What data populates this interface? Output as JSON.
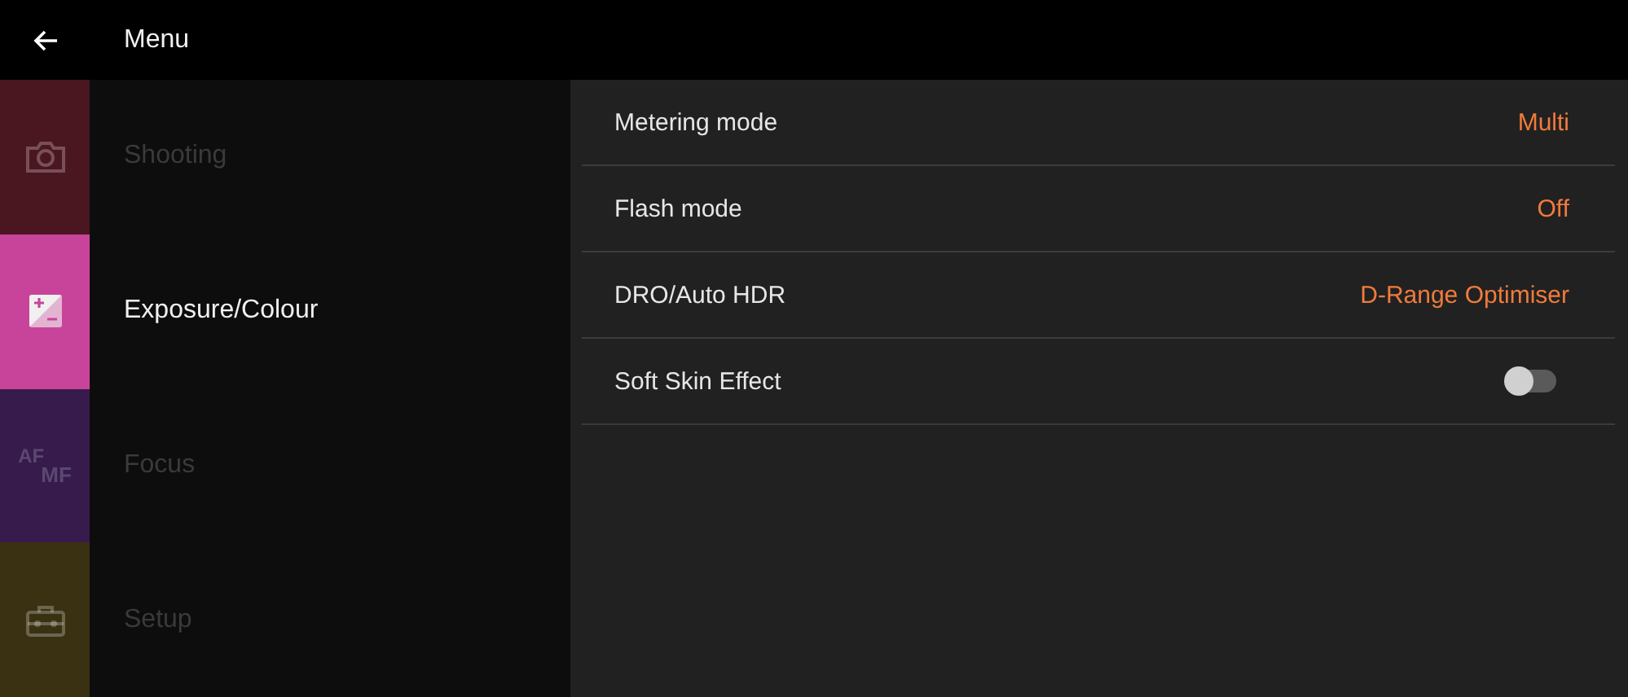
{
  "header": {
    "title": "Menu"
  },
  "categories": [
    {
      "kind": "camera",
      "label": "Shooting",
      "color": "#4a1620",
      "selected": false
    },
    {
      "kind": "exposure",
      "label": "Exposure/Colour",
      "color": "#c8449a",
      "selected": true
    },
    {
      "kind": "af-mf",
      "label": "Focus",
      "color": "#371b4c",
      "selected": false,
      "icon_text": [
        "AF",
        "MF"
      ]
    },
    {
      "kind": "toolbox",
      "label": "Setup",
      "color": "#3a3113",
      "selected": false
    }
  ],
  "settings": [
    {
      "kind": "value",
      "label": "Metering mode",
      "value": "Multi"
    },
    {
      "kind": "value",
      "label": "Flash mode",
      "value": "Off"
    },
    {
      "kind": "value",
      "label": "DRO/Auto HDR",
      "value": "D-Range Optimiser"
    },
    {
      "kind": "toggle",
      "label": "Soft Skin Effect",
      "on": false
    }
  ]
}
